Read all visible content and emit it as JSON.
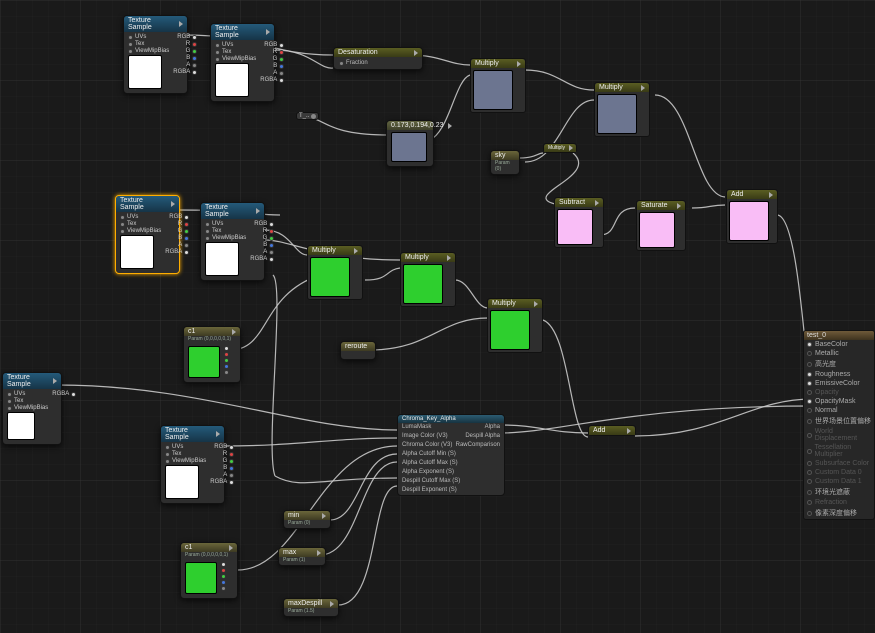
{
  "nodes": {
    "tex_sample": "Texture Sample",
    "pins_in": [
      "UVs",
      "Tex",
      "ViewMipBias"
    ],
    "pins_out": [
      "RGB",
      "R",
      "G",
      "B",
      "A",
      "RGBA"
    ],
    "desat": {
      "title": "Desaturation",
      "in": "Fraction"
    },
    "multiply": "Multiply",
    "subtract": "Subtract",
    "saturate": "Saturate",
    "add": "Add",
    "reroute": "reroute",
    "const_label": "0.173,0.194,0.23",
    "t_label": "T_..",
    "sky": {
      "name": "sky",
      "sub": "Param (0)"
    },
    "c1": {
      "name": "c1",
      "sub": "Param (0,0,0,0,0,1)"
    },
    "min_p": {
      "name": "min",
      "sub": "Param (0)"
    },
    "max_p": {
      "name": "max",
      "sub": "Param (1)"
    },
    "maxDespill": {
      "name": "maxDespill",
      "sub": "Param (1.5)"
    }
  },
  "chroma": {
    "title": "Chroma_Key_Alpha",
    "inputs": [
      "LumaMask",
      "Image Color (V3)",
      "Chroma Color (V3)",
      "Alpha Cutoff Min (S)",
      "Alpha Cutoff Max (S)",
      "Alpha Exponent (S)",
      "Despill Cutoff Max (S)",
      "Despill Exponent (S)"
    ],
    "outputs": [
      "Alpha",
      "Despill Alpha",
      "RawComparison"
    ]
  },
  "result": {
    "title": "test_0",
    "items": [
      {
        "label": "BaseColor",
        "on": true
      },
      {
        "label": "Metallic",
        "on": false
      },
      {
        "label": "高光度",
        "on": false
      },
      {
        "label": "Roughness",
        "on": true
      },
      {
        "label": "EmissiveColor",
        "on": true
      },
      {
        "label": "Opacity",
        "on": false,
        "dim": true
      },
      {
        "label": "OpacityMask",
        "on": true
      },
      {
        "label": "Normal",
        "on": false
      },
      {
        "label": "世界场景位置偏移",
        "on": false
      },
      {
        "label": "World Displacement",
        "on": false,
        "dim": true
      },
      {
        "label": "Tessellation Multiplier",
        "on": false,
        "dim": true
      },
      {
        "label": "Subsurface Color",
        "on": false,
        "dim": true
      },
      {
        "label": "Custom Data 0",
        "on": false,
        "dim": true
      },
      {
        "label": "Custom Data 1",
        "on": false,
        "dim": true
      },
      {
        "label": "环境光遮蔽",
        "on": false
      },
      {
        "label": "Refraction",
        "on": false,
        "dim": true
      },
      {
        "label": "像素深度偏移",
        "on": false
      }
    ]
  },
  "colors": {
    "white": "#ffffff",
    "green": "#2ecf2e",
    "slate": "#6c7590",
    "pink": "#f9bdf6"
  }
}
